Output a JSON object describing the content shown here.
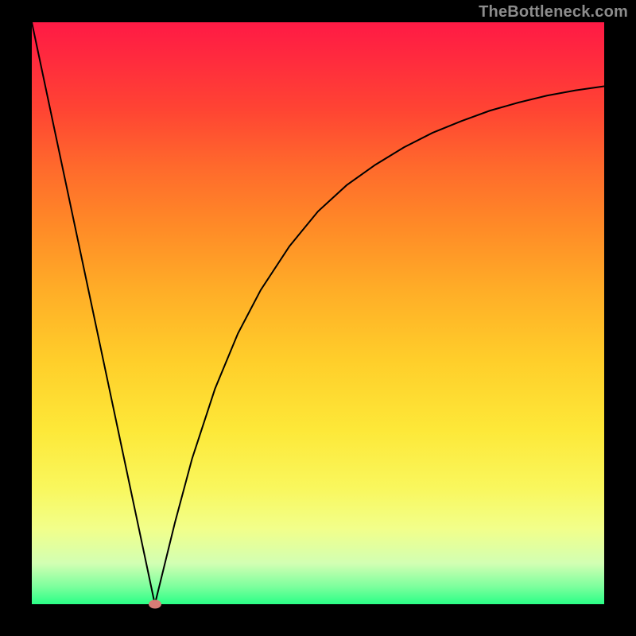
{
  "watermark": "TheBottleneck.com",
  "chart_data": {
    "type": "line",
    "title": "",
    "xlabel": "",
    "ylabel": "",
    "xlim": [
      0,
      100
    ],
    "ylim": [
      0,
      100
    ],
    "grid": false,
    "legend": false,
    "background_gradient": {
      "direction": "top-to-bottom",
      "stops": [
        {
          "pos": 0.0,
          "color": "#ff1a45"
        },
        {
          "pos": 0.06,
          "color": "#ff2a3e"
        },
        {
          "pos": 0.15,
          "color": "#ff4433"
        },
        {
          "pos": 0.25,
          "color": "#ff6a2c"
        },
        {
          "pos": 0.35,
          "color": "#ff8a27"
        },
        {
          "pos": 0.46,
          "color": "#ffad27"
        },
        {
          "pos": 0.58,
          "color": "#ffce2a"
        },
        {
          "pos": 0.7,
          "color": "#fde838"
        },
        {
          "pos": 0.8,
          "color": "#f9f75d"
        },
        {
          "pos": 0.87,
          "color": "#f2ff8a"
        },
        {
          "pos": 0.93,
          "color": "#d2ffb3"
        },
        {
          "pos": 0.97,
          "color": "#7cff9d"
        },
        {
          "pos": 1.0,
          "color": "#2aff87"
        }
      ]
    },
    "series": [
      {
        "name": "bottleneck-curve",
        "stroke": "#000000",
        "stroke_width": 2,
        "x": [
          0.0,
          2.0,
          4.0,
          6.0,
          8.0,
          10.0,
          12.0,
          14.0,
          16.0,
          18.0,
          20.0,
          21.5,
          23.0,
          25.0,
          28.0,
          32.0,
          36.0,
          40.0,
          45.0,
          50.0,
          55.0,
          60.0,
          65.0,
          70.0,
          75.0,
          80.0,
          85.0,
          90.0,
          95.0,
          100.0
        ],
        "y": [
          100.0,
          90.7,
          81.4,
          72.1,
          62.8,
          53.5,
          44.2,
          34.9,
          25.6,
          16.3,
          7.0,
          0.0,
          6.0,
          14.0,
          25.0,
          37.0,
          46.5,
          54.0,
          61.5,
          67.5,
          72.0,
          75.5,
          78.5,
          81.0,
          83.0,
          84.8,
          86.2,
          87.4,
          88.3,
          89.0
        ]
      }
    ],
    "marker": {
      "name": "optimal-point",
      "x": 21.5,
      "y": 0.0,
      "color": "#d77c76",
      "shape": "ellipse",
      "rx": 8,
      "ry": 5.5
    }
  }
}
